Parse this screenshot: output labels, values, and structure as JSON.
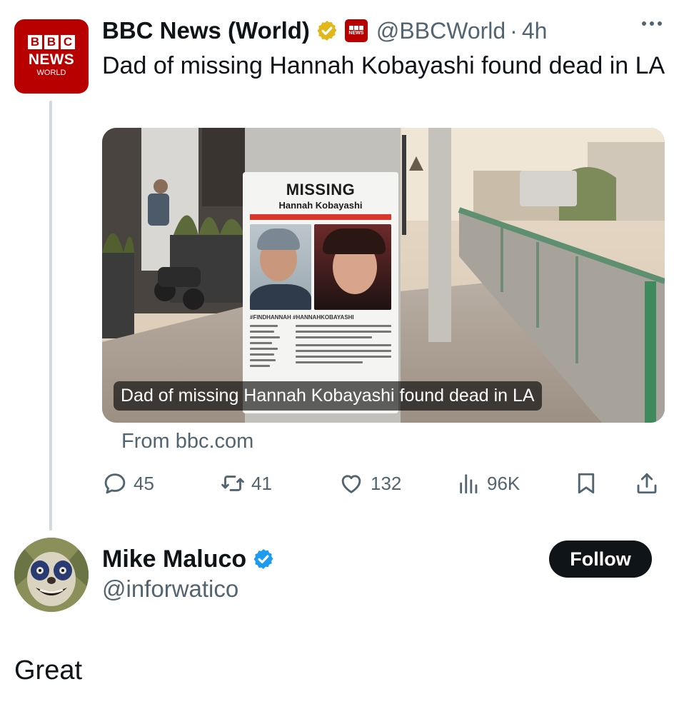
{
  "tweet": {
    "display_name": "BBC News (World)",
    "handle": "@BBCWorld",
    "separator": "·",
    "time": "4h",
    "text": "Dad of missing Hannah Kobayashi found dead in LA",
    "avatar": {
      "logo_blocks": [
        "B",
        "B",
        "C"
      ],
      "logo_text": "NEWS",
      "logo_sub": "WORLD"
    },
    "badges": [
      "gold-verified-badge",
      "bbc-affiliate-badge"
    ]
  },
  "media": {
    "caption": "Dad of missing Hannah Kobayashi found dead in LA",
    "source": "From bbc.com",
    "poster": {
      "title": "MISSING",
      "name": "Hannah Kobayashi",
      "tags": "#FINDHANNAH #HANNAHKOBAYASHI"
    }
  },
  "actions": {
    "replies": "45",
    "reposts": "41",
    "likes": "132",
    "views": "96K"
  },
  "reply": {
    "display_name": "Mike Maluco",
    "handle": "@inforwatico",
    "follow_label": "Follow",
    "text": "Great"
  },
  "colors": {
    "bbc_red": "#b80000",
    "text_primary": "#0f1419",
    "text_secondary": "#536471",
    "verified_blue": "#1d9bf0",
    "verified_gold": "#e2b719",
    "follow_bg": "#0f1419"
  }
}
